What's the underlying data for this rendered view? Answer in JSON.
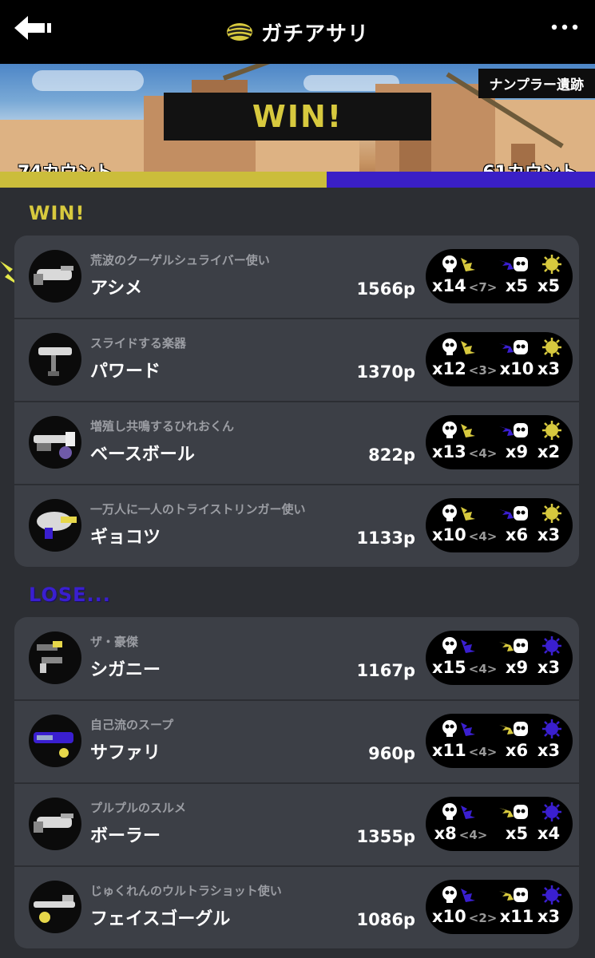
{
  "header": {
    "title": "ガチアサリ",
    "back_icon": "back-arrow-icon",
    "menu_icon": "more-dots-icon",
    "mode_icon": "clam-icon"
  },
  "banner": {
    "stage": "ナンプラー遺跡",
    "result": "WIN!",
    "my_count": "74カウント",
    "enemy_count": "61カウント",
    "my_color": "#cbbd3b",
    "enemy_color": "#3a1fc6"
  },
  "win_section": {
    "title": "WIN!",
    "players": [
      {
        "nickname": "荒波のクーゲルシュライバー使い",
        "name": "アシメ",
        "points": "1566p",
        "kills": "x14",
        "assists": "<7>",
        "deaths": "x5",
        "specials": "x5",
        "weapon": "kugelschreiber-icon",
        "special_icon": "inkjet-icon"
      },
      {
        "nickname": "スライドする楽器",
        "name": "パワード",
        "points": "1370p",
        "kills": "x12",
        "assists": "<3>",
        "deaths": "x10",
        "specials": "x3",
        "weapon": "trombone-roller-icon",
        "special_icon": "booyah-bomb-icon"
      },
      {
        "nickname": "増殖し共鳴するひれおくん",
        "name": "ベースボール",
        "points": "822p",
        "kills": "x13",
        "assists": "<4>",
        "deaths": "x9",
        "specials": "x2",
        "weapon": "charger-icon",
        "special_icon": "splash-bomb-icon"
      },
      {
        "nickname": "一万人に一人のトライストリンガー使い",
        "name": "ギョコツ",
        "points": "1133p",
        "kills": "x10",
        "assists": "<4>",
        "deaths": "x6",
        "specials": "x3",
        "weapon": "blaster-icon",
        "special_icon": "torpedo-icon"
      }
    ]
  },
  "lose_section": {
    "title": "LOSE...",
    "players": [
      {
        "nickname": "ザ・豪傑",
        "name": "シガニー",
        "points": "1167p",
        "kills": "x15",
        "assists": "<4>",
        "deaths": "x9",
        "specials": "x3",
        "weapon": "dualies-icon",
        "special_icon": "crab-tank-icon"
      },
      {
        "nickname": "自己流のスープ",
        "name": "サファリ",
        "points": "960p",
        "kills": "x11",
        "assists": "<4>",
        "deaths": "x6",
        "specials": "x3",
        "weapon": "spinner-icon",
        "special_icon": "tenta-missiles-icon"
      },
      {
        "nickname": "プルプルのスルメ",
        "name": "ボーラー",
        "points": "1355p",
        "kills": "x8",
        "assists": "<4>",
        "deaths": "x5",
        "specials": "x4",
        "weapon": "kugelschreiber-icon",
        "special_icon": "inkjet-icon"
      },
      {
        "nickname": "じゅくれんのウルトラショット使い",
        "name": "フェイスゴーグル",
        "points": "1086p",
        "kills": "x10",
        "assists": "<2>",
        "deaths": "x11",
        "specials": "x3",
        "weapon": "stringer-icon",
        "special_icon": "ultra-stamp-icon"
      }
    ]
  }
}
